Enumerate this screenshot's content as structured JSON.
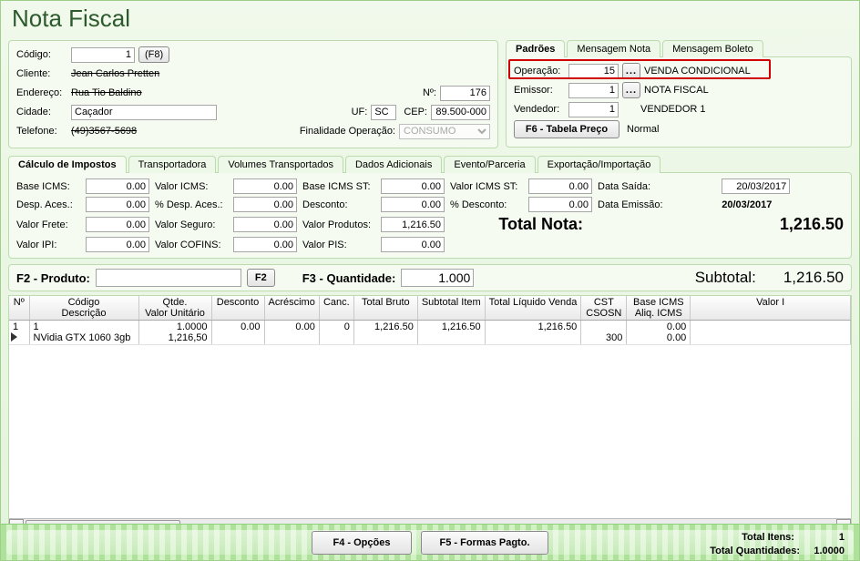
{
  "title": "Nota Fiscal",
  "left": {
    "codigo_label": "Código:",
    "codigo_value": "1",
    "f8_label": "(F8)",
    "cliente_label": "Cliente:",
    "cliente_value": "Jean Carlos Pretten",
    "endereco_label": "Endereço:",
    "endereco_value": "Rua Tio Baldino",
    "num_label": "Nº:",
    "num_value": "176",
    "cidade_label": "Cidade:",
    "cidade_value": "Caçador",
    "uf_label": "UF:",
    "uf_value": "SC",
    "cep_label": "CEP:",
    "cep_value": "89.500-000",
    "telefone_label": "Telefone:",
    "telefone_value": "(49)3567-5698",
    "finalidade_label": "Finalidade Operação:",
    "finalidade_value": "CONSUMO"
  },
  "right": {
    "tabs": [
      "Padrões",
      "Mensagem Nota",
      "Mensagem Boleto"
    ],
    "operacao_label": "Operação:",
    "operacao_value": "15",
    "operacao_desc": "VENDA CONDICIONAL",
    "emissor_label": "Emissor:",
    "emissor_value": "1",
    "emissor_desc": "NOTA FISCAL",
    "vendedor_label": "Vendedor:",
    "vendedor_value": "1",
    "vendedor_desc": "VENDEDOR 1",
    "f6_label": "F6 - Tabela Preço",
    "f6_desc": "Normal"
  },
  "tax_tabs": [
    "Cálculo de Impostos",
    "Transportadora",
    "Volumes Transportados",
    "Dados Adicionais",
    "Evento/Parceria",
    "Exportação/Importação"
  ],
  "tax": {
    "base_icms_l": "Base ICMS:",
    "base_icms_v": "0.00",
    "valor_icms_l": "Valor ICMS:",
    "valor_icms_v": "0.00",
    "base_icms_st_l": "Base ICMS ST:",
    "base_icms_st_v": "0.00",
    "valor_icms_st_l": "Valor ICMS ST:",
    "valor_icms_st_v": "0.00",
    "data_saida_l": "Data Saída:",
    "data_saida_v": "20/03/2017",
    "desp_aces_l": "Desp. Aces.:",
    "desp_aces_v": "0.00",
    "pct_desp_l": "% Desp. Aces.:",
    "pct_desp_v": "0.00",
    "desconto_l": "Desconto:",
    "desconto_v": "0.00",
    "pct_desc_l": "% Desconto:",
    "pct_desc_v": "0.00",
    "data_emissao_l": "Data Emissão:",
    "data_emissao_v": "20/03/2017",
    "valor_frete_l": "Valor Frete:",
    "valor_frete_v": "0.00",
    "valor_seguro_l": "Valor Seguro:",
    "valor_seguro_v": "0.00",
    "valor_produtos_l": "Valor Produtos:",
    "valor_produtos_v": "1,216.50",
    "total_nota_l": "Total Nota:",
    "total_nota_v": "1,216.50",
    "valor_ipi_l": "Valor IPI:",
    "valor_ipi_v": "0.00",
    "valor_cofins_l": "Valor COFINS:",
    "valor_cofins_v": "0.00",
    "valor_pis_l": "Valor PIS:",
    "valor_pis_v": "0.00"
  },
  "prod": {
    "f2_label": "F2 - Produto:",
    "f2_btn": "F2",
    "f3_label": "F3 - Quantidade:",
    "f3_value": "1.000",
    "subtotal_l": "Subtotal:",
    "subtotal_v": "1,216.50"
  },
  "grid": {
    "headers": [
      [
        "Nº",
        ""
      ],
      [
        "Código",
        "Descrição"
      ],
      [
        "Qtde.",
        "Valor Unitário"
      ],
      [
        "Desconto",
        ""
      ],
      [
        "Acréscimo",
        ""
      ],
      [
        "Canc.",
        ""
      ],
      [
        "Total Bruto",
        ""
      ],
      [
        "Subtotal Item",
        ""
      ],
      [
        "Total Líquido Venda",
        ""
      ],
      [
        "CST",
        "CSOSN"
      ],
      [
        "Base ICMS",
        "Aliq. ICMS"
      ],
      [
        "Valor I",
        ""
      ]
    ],
    "row": {
      "n": "1",
      "codigo": "1",
      "descricao": "NVidia GTX 1060 3gb",
      "qtde": "1.0000",
      "unit": "1,216,50",
      "desconto": "0.00",
      "acrescimo": "0.00",
      "canc": "0",
      "total_bruto": "1,216.50",
      "subtotal": "1,216.50",
      "total_liq": "1,216.50",
      "cst": "",
      "csosn": "300",
      "base_icms": "0.00",
      "aliq_icms": "0.00"
    }
  },
  "bottom": {
    "f4": "F4 - Opções",
    "f5": "F5 - Formas Pagto.",
    "itens_l": "Total Itens:",
    "itens_v": "1",
    "qtd_l": "Total Quantidades:",
    "qtd_v": "1.0000"
  }
}
